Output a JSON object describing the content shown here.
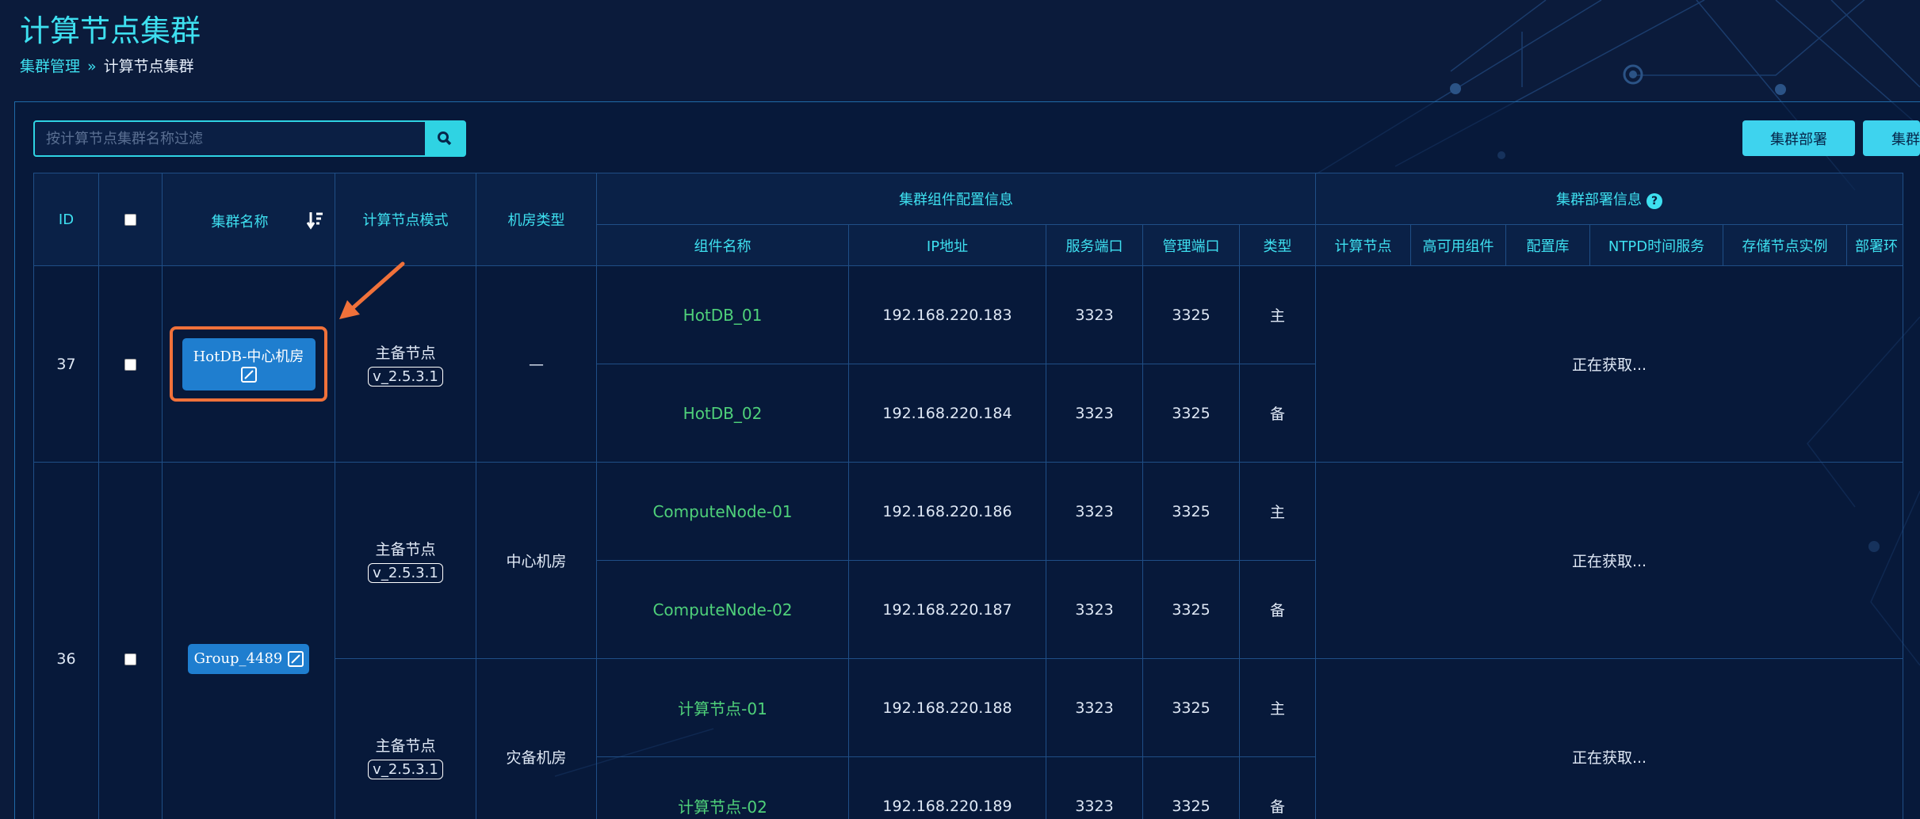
{
  "page_title": "计算节点集群",
  "breadcrumb": {
    "parent": "集群管理",
    "separator": "»",
    "current": "计算节点集群"
  },
  "search": {
    "placeholder": "按计算节点集群名称过滤"
  },
  "buttons": {
    "deploy": "集群部署",
    "second": "集群"
  },
  "table": {
    "headers": {
      "id": "ID",
      "name": "集群名称",
      "mode": "计算节点模式",
      "room": "机房类型",
      "component_group": "集群组件配置信息",
      "deploy_group": "集群部署信息",
      "component_name": "组件名称",
      "ip": "IP地址",
      "service_port": "服务端口",
      "manage_port": "管理端口",
      "type": "类型",
      "compute_node": "计算节点",
      "ha": "高可用组件",
      "config_db": "配置库",
      "ntpd": "NTPD时间服务",
      "storage": "存储节点实例",
      "deploy_env": "部署环"
    },
    "rows": [
      {
        "id": "37",
        "name": "HotDB-中心机房",
        "mode": "主备节点",
        "version": "v_2.5.3.1",
        "room": "—",
        "deploy_status": "正在获取...",
        "comps": [
          {
            "name": "HotDB_01",
            "ip": "192.168.220.183",
            "service_port": "3323",
            "manage_port": "3325",
            "type": "主"
          },
          {
            "name": "HotDB_02",
            "ip": "192.168.220.184",
            "service_port": "3323",
            "manage_port": "3325",
            "type": "备"
          }
        ]
      },
      {
        "id": "36",
        "name": "Group_4489",
        "subgroups": [
          {
            "mode": "主备节点",
            "version": "v_2.5.3.1",
            "room": "中心机房",
            "deploy_status": "正在获取...",
            "comps": [
              {
                "name": "ComputeNode-01",
                "ip": "192.168.220.186",
                "service_port": "3323",
                "manage_port": "3325",
                "type": "主"
              },
              {
                "name": "ComputeNode-02",
                "ip": "192.168.220.187",
                "service_port": "3323",
                "manage_port": "3325",
                "type": "备"
              }
            ]
          },
          {
            "mode": "主备节点",
            "version": "v_2.5.3.1",
            "room": "灾备机房",
            "deploy_status": "正在获取...",
            "comps": [
              {
                "name": "计算节点-01",
                "ip": "192.168.220.188",
                "service_port": "3323",
                "manage_port": "3325",
                "type": "主"
              },
              {
                "name": "计算节点-02",
                "ip": "192.168.220.189",
                "service_port": "3323",
                "manage_port": "3325",
                "type": "备"
              }
            ]
          }
        ]
      }
    ]
  },
  "colors": {
    "accent": "#3ee0f0",
    "highlight": "#f0713a",
    "component_green": "#4fd17a"
  },
  "icons": {
    "search": "search-icon",
    "sort": "sort-icon",
    "edit": "edit-icon",
    "help": "help-icon",
    "arrow": "annotation-arrow"
  }
}
